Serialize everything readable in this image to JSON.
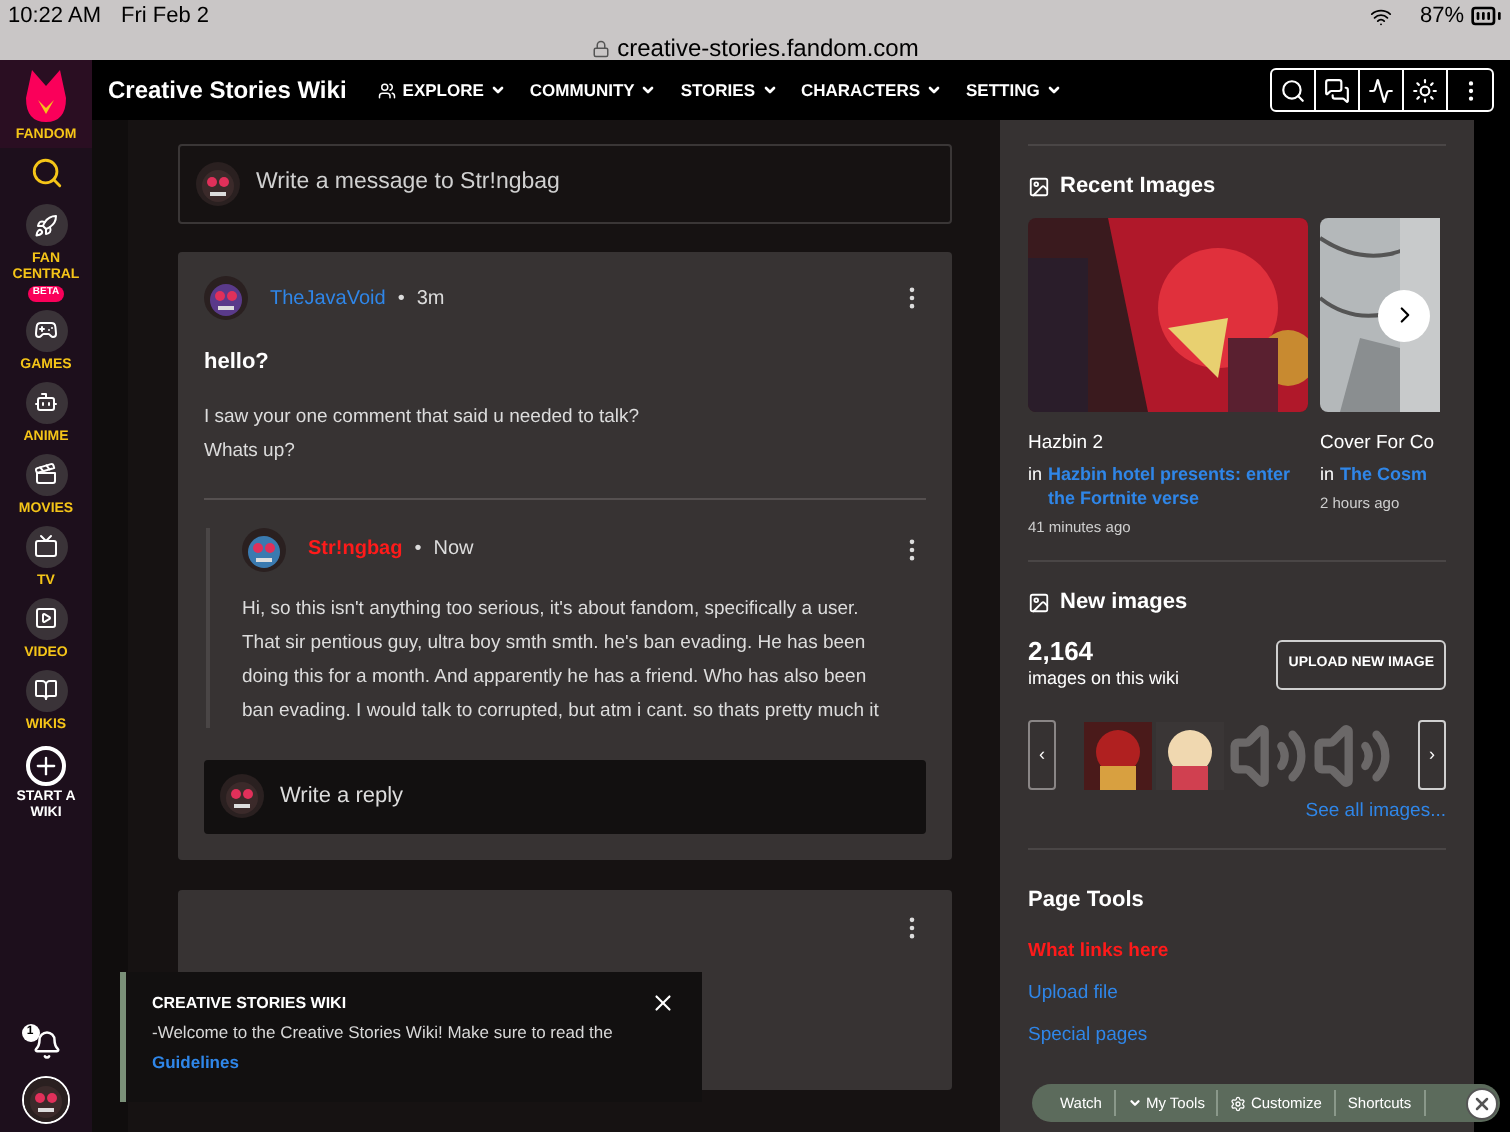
{
  "status_bar": {
    "time": "10:22 AM",
    "date": "Fri Feb 2",
    "url": "creative-stories.fandom.com",
    "battery": "87%"
  },
  "wiki_nav": {
    "title": "Creative Stories Wiki",
    "menus": [
      {
        "label": "EXPLORE",
        "kind": "explore"
      },
      {
        "label": "COMMUNITY",
        "kind": "plain"
      },
      {
        "label": "STORIES",
        "kind": "plain"
      },
      {
        "label": "CHARACTERS",
        "kind": "plain"
      },
      {
        "label": "SETTING",
        "kind": "plain"
      }
    ]
  },
  "sidebar": {
    "logo": "FANDOM",
    "items": [
      {
        "label": "FAN CENTRAL",
        "badge": "BETA"
      },
      {
        "label": "GAMES"
      },
      {
        "label": "ANIME"
      },
      {
        "label": "MOVIES"
      },
      {
        "label": "TV"
      },
      {
        "label": "VIDEO"
      },
      {
        "label": "WIKIS"
      }
    ],
    "start": "START A WIKI",
    "notifications": "1"
  },
  "composer": {
    "placeholder": "Write a message to Str!ngbag"
  },
  "post": {
    "author": "TheJavaVoid",
    "separator": "•",
    "time": "3m",
    "title": "hello?",
    "lines": [
      "I saw your one comment that said u needed to talk?",
      "Whats up?"
    ],
    "reply": {
      "author": "Str!ngbag",
      "separator": "•",
      "time": "Now",
      "body": "Hi, so this isn't anything too serious, it's about fandom, specifically a user. That sir pentious guy, ultra boy smth smth. he's ban evading. He has been doing this for a month. And apparently he has a friend. Who has also been ban evading. I would talk to corrupted, but atm i cant.  so thats pretty much it"
    },
    "reply_placeholder": "Write a reply"
  },
  "toast": {
    "title": "CREATIVE STORIES WIKI",
    "text": "-Welcome to the Creative Stories Wiki! Make sure to read the",
    "link": "Guidelines"
  },
  "recent_images": {
    "title": "Recent Images",
    "items": [
      {
        "name": "Hazbin 2",
        "in": "in",
        "wiki": "Hazbin hotel presents: enter the Fortnite verse",
        "time": "41 minutes ago",
        "kind": "red"
      },
      {
        "name": "Cover For Co",
        "in": "in",
        "wiki": "The Cosm",
        "time": "2 hours ago",
        "kind": "sketch"
      }
    ]
  },
  "new_images": {
    "title": "New images",
    "count": "2,164",
    "count_label": "images on this wiki",
    "upload": "UPLOAD NEW IMAGE",
    "prev": "‹",
    "next": "›",
    "thumbs": [
      {
        "kind": "picture"
      },
      {
        "kind": "picture"
      },
      {
        "kind": "audio"
      },
      {
        "kind": "audio"
      }
    ],
    "see_all": "See all images..."
  },
  "page_tools": {
    "title": "Page Tools",
    "links": [
      {
        "label": "What links here",
        "missing": true
      },
      {
        "label": "Upload file",
        "missing": false
      },
      {
        "label": "Special pages",
        "missing": false
      }
    ]
  },
  "toolbar": {
    "items": [
      {
        "label": "Watch",
        "kind": "plain"
      },
      {
        "label": "My Tools",
        "kind": "menu"
      },
      {
        "label": "Customize",
        "kind": "gear"
      },
      {
        "label": "Shortcuts",
        "kind": "plain"
      }
    ]
  }
}
